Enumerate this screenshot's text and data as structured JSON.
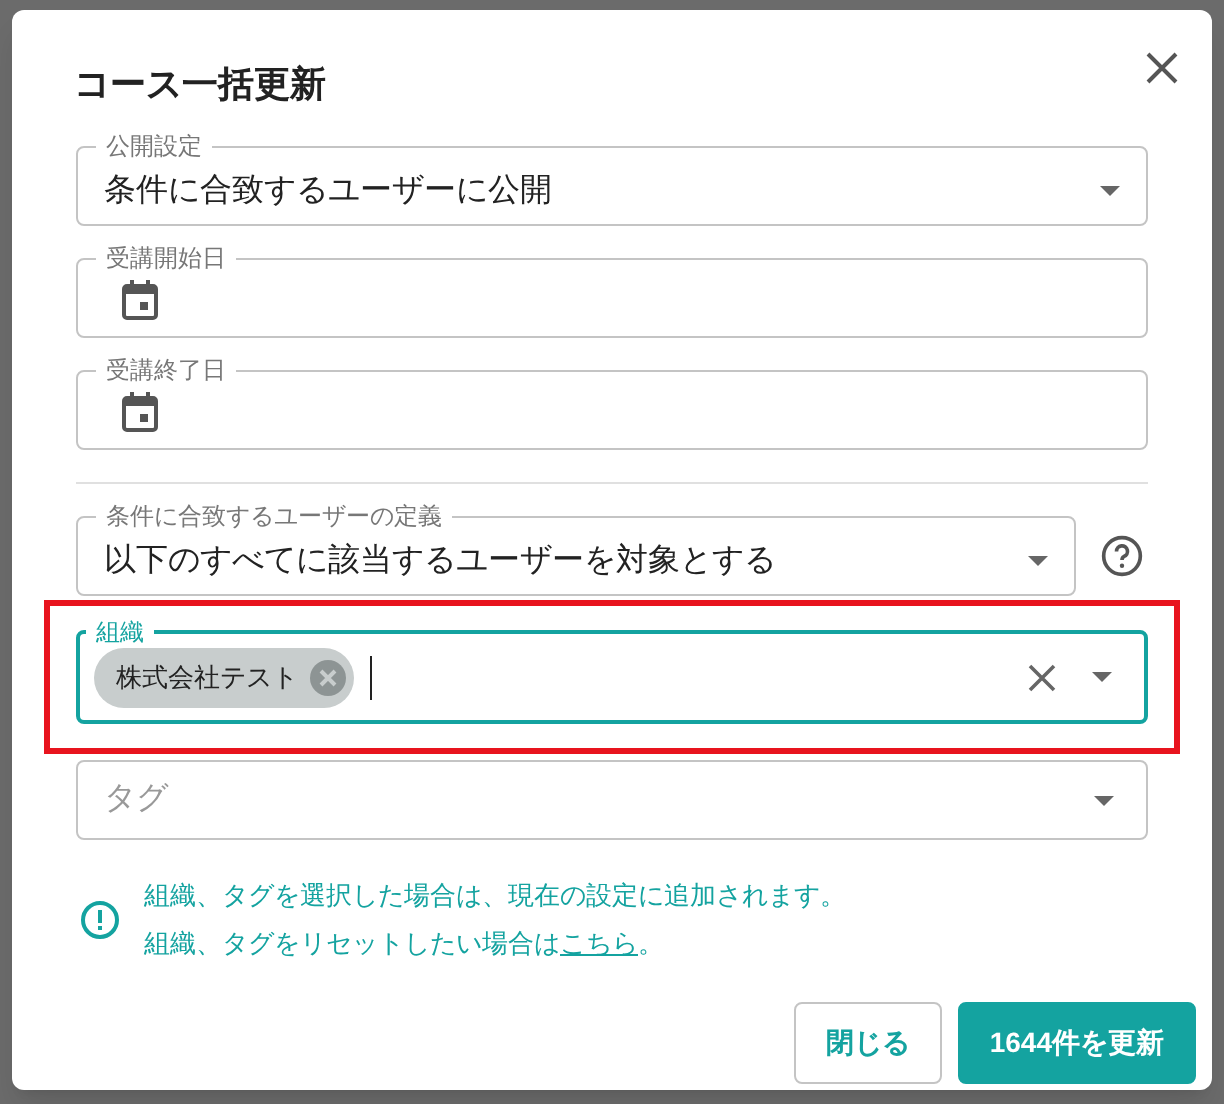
{
  "dialog": {
    "title": "コース一括更新",
    "fields": [
      {
        "kind": "select",
        "label": "公開設定",
        "value": "条件に合致するユーザーに公開"
      },
      {
        "kind": "date",
        "label": "受講開始日"
      },
      {
        "kind": "date",
        "label": "受講終了日"
      },
      {
        "kind": "divider"
      },
      {
        "kind": "select",
        "label": "条件に合致するユーザーの定義",
        "value": "以下のすべてに該当するユーザーを対象とする",
        "help": true
      },
      {
        "kind": "chips",
        "label": "組織",
        "chips": [
          "株式会社テスト"
        ],
        "focused": true,
        "highlighted": true
      },
      {
        "kind": "chips",
        "placeholder": "タグ",
        "focused": false,
        "highlighted": false
      }
    ],
    "notice": {
      "line_1": "組織、タグを選択した場合は、現在の設定に追加されます。",
      "line_2_before": "組織、タグをリセットしたい場合は",
      "line_2_link": "こちら",
      "line_2_after": "。"
    },
    "buttons": [
      {
        "kind": "outline",
        "label": "閉じる"
      },
      {
        "kind": "primary",
        "label": "1644件を更新"
      }
    ]
  }
}
